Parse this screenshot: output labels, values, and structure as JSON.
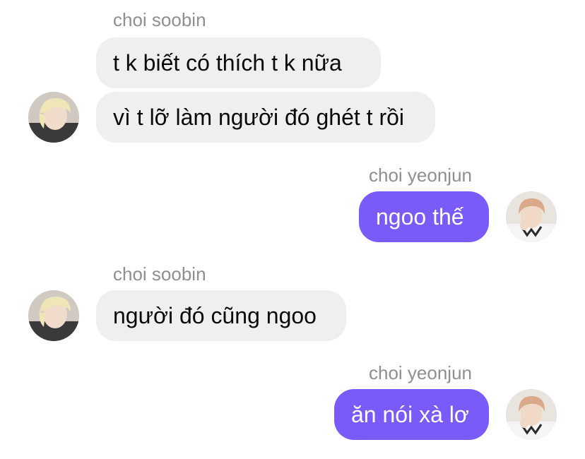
{
  "thread": {
    "groups": [
      {
        "sender": "choi soobin",
        "direction": "incoming",
        "avatar_icon": "soobin-avatar",
        "messages": [
          "t k biết có thích t k nữa",
          "vì t lỡ làm người đó ghét t rồi"
        ]
      },
      {
        "sender": "choi yeonjun",
        "direction": "outgoing",
        "avatar_icon": "yeonjun-avatar",
        "messages": [
          "ngoo thế"
        ]
      },
      {
        "sender": "choi soobin",
        "direction": "incoming",
        "avatar_icon": "soobin-avatar",
        "messages": [
          "người đó cũng ngoo"
        ]
      },
      {
        "sender": "choi yeonjun",
        "direction": "outgoing",
        "avatar_icon": "yeonjun-avatar",
        "messages": [
          "ăn nói xà lơ"
        ]
      }
    ]
  },
  "colors": {
    "incoming_bubble": "#efefef",
    "outgoing_bubble": "#7a5af8",
    "sender_name": "#8e8e93"
  }
}
